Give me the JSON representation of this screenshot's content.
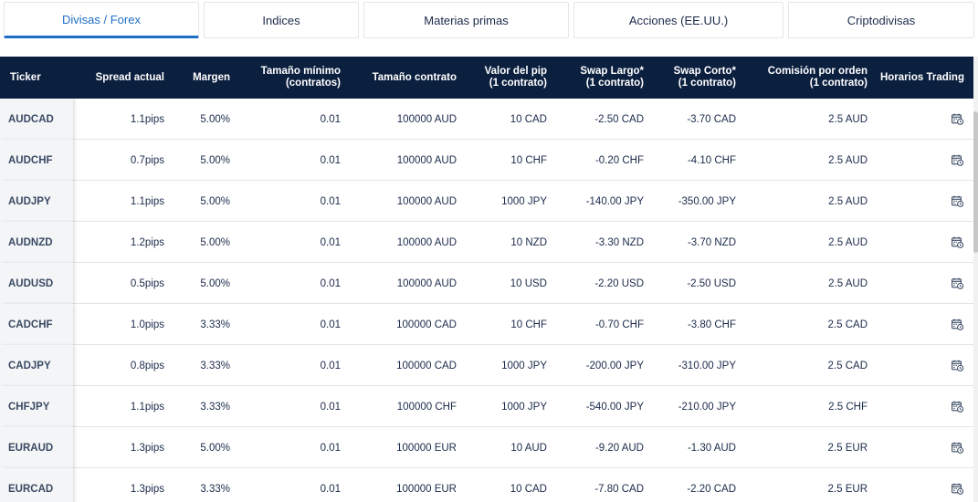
{
  "tabs": [
    {
      "label": "Divisas / Forex",
      "active": true
    },
    {
      "label": "Indices",
      "active": false
    },
    {
      "label": "Materias primas",
      "active": false
    },
    {
      "label": "Acciones (EE.UU.)",
      "active": false
    },
    {
      "label": "Criptodivisas",
      "active": false
    }
  ],
  "table": {
    "headers": {
      "ticker": "Ticker",
      "spread": "Spread actual",
      "margin": "Margen",
      "min_size_1": "Tamaño mínimo",
      "min_size_2": "(contratos)",
      "contract_size": "Tamaño contrato",
      "pip_value_1": "Valor del pip",
      "pip_value_2": "(1 contrato)",
      "swap_long_1": "Swap Largo*",
      "swap_long_2": "(1 contrato)",
      "swap_short_1": "Swap Corto*",
      "swap_short_2": "(1 contrato)",
      "commission_1": "Comisión por orden",
      "commission_2": "(1 contrato)",
      "hours": "Horarios Trading"
    },
    "rows": [
      {
        "ticker": "AUDCAD",
        "spread": "1.1pips",
        "margin": "5.00%",
        "min_size": "0.01",
        "contract": "100000 AUD",
        "pip": "10 CAD",
        "swap_long": "-2.50 CAD",
        "swap_short": "-3.70 CAD",
        "commission": "2.5 AUD"
      },
      {
        "ticker": "AUDCHF",
        "spread": "0.7pips",
        "margin": "5.00%",
        "min_size": "0.01",
        "contract": "100000 AUD",
        "pip": "10 CHF",
        "swap_long": "-0.20 CHF",
        "swap_short": "-4.10 CHF",
        "commission": "2.5 AUD"
      },
      {
        "ticker": "AUDJPY",
        "spread": "1.1pips",
        "margin": "5.00%",
        "min_size": "0.01",
        "contract": "100000 AUD",
        "pip": "1000 JPY",
        "swap_long": "-140.00 JPY",
        "swap_short": "-350.00 JPY",
        "commission": "2.5 AUD"
      },
      {
        "ticker": "AUDNZD",
        "spread": "1.2pips",
        "margin": "5.00%",
        "min_size": "0.01",
        "contract": "100000 AUD",
        "pip": "10 NZD",
        "swap_long": "-3.30 NZD",
        "swap_short": "-3.70 NZD",
        "commission": "2.5 AUD"
      },
      {
        "ticker": "AUDUSD",
        "spread": "0.5pips",
        "margin": "5.00%",
        "min_size": "0.01",
        "contract": "100000 AUD",
        "pip": "10 USD",
        "swap_long": "-2.20 USD",
        "swap_short": "-2.50 USD",
        "commission": "2.5 AUD"
      },
      {
        "ticker": "CADCHF",
        "spread": "1.0pips",
        "margin": "3.33%",
        "min_size": "0.01",
        "contract": "100000 CAD",
        "pip": "10 CHF",
        "swap_long": "-0.70 CHF",
        "swap_short": "-3.80 CHF",
        "commission": "2.5 CAD"
      },
      {
        "ticker": "CADJPY",
        "spread": "0.8pips",
        "margin": "3.33%",
        "min_size": "0.01",
        "contract": "100000 CAD",
        "pip": "1000 JPY",
        "swap_long": "-200.00 JPY",
        "swap_short": "-310.00 JPY",
        "commission": "2.5 CAD"
      },
      {
        "ticker": "CHFJPY",
        "spread": "1.1pips",
        "margin": "3.33%",
        "min_size": "0.01",
        "contract": "100000 CHF",
        "pip": "1000 JPY",
        "swap_long": "-540.00 JPY",
        "swap_short": "-210.00 JPY",
        "commission": "2.5 CHF"
      },
      {
        "ticker": "EURAUD",
        "spread": "1.3pips",
        "margin": "5.00%",
        "min_size": "0.01",
        "contract": "100000 EUR",
        "pip": "10 AUD",
        "swap_long": "-9.20 AUD",
        "swap_short": "-1.30 AUD",
        "commission": "2.5 EUR"
      },
      {
        "ticker": "EURCAD",
        "spread": "1.3pips",
        "margin": "3.33%",
        "min_size": "0.01",
        "contract": "100000 EUR",
        "pip": "10 CAD",
        "swap_long": "-7.80 CAD",
        "swap_short": "-2.20 CAD",
        "commission": "2.5 EUR"
      }
    ]
  },
  "icons": {
    "hours": "calendar-clock-icon"
  },
  "colors": {
    "header_bg": "#0b1f3f",
    "active_tab": "#1f6fc7"
  }
}
